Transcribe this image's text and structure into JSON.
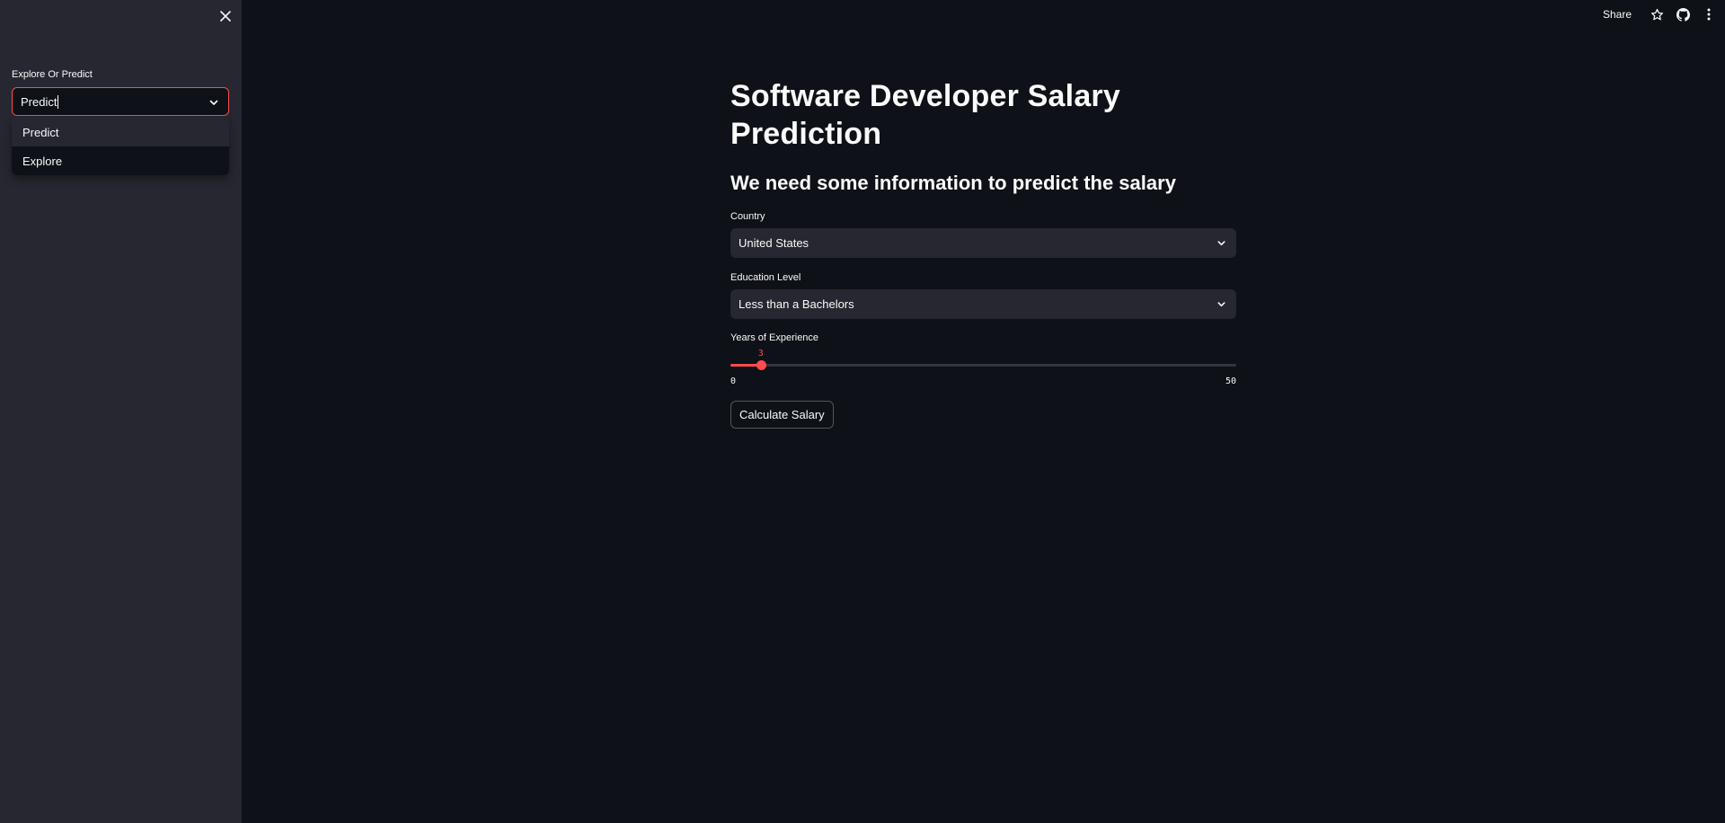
{
  "sidebar": {
    "select_label": "Explore Or Predict",
    "select_value": "Predict",
    "options": [
      {
        "label": "Predict"
      },
      {
        "label": "Explore"
      }
    ]
  },
  "toolbar": {
    "share_label": "Share",
    "icons": [
      "star-icon",
      "github-icon",
      "more-vertical-icon"
    ]
  },
  "main": {
    "title": "Software Developer Salary Prediction",
    "subtitle": "We need some information to predict the salary",
    "country": {
      "label": "Country",
      "value": "United States"
    },
    "education": {
      "label": "Education Level",
      "value": "Less than a Bachelors"
    },
    "experience": {
      "label": "Years of Experience",
      "value": 3,
      "min": 0,
      "max": 50
    },
    "button_label": "Calculate Salary"
  },
  "colors": {
    "accent": "#ff4b4b",
    "background": "#0e1117",
    "sidebar": "#262730",
    "text": "#fafafa"
  }
}
